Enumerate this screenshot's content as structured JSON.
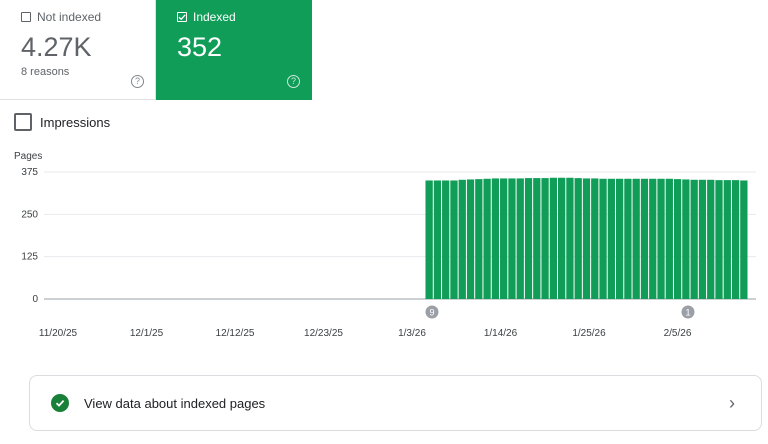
{
  "cards": {
    "not_indexed": {
      "label": "Not indexed",
      "value": "4.27K",
      "sub": "8 reasons",
      "checked": false
    },
    "indexed": {
      "label": "Indexed",
      "value": "352",
      "checked": true
    }
  },
  "impressions": {
    "label": "Impressions",
    "checked": false
  },
  "colors": {
    "indexed": "#0f9d58",
    "accent_check": "#188038"
  },
  "chart_data": {
    "type": "bar",
    "ylabel": "Pages",
    "ylim": [
      0,
      375
    ],
    "yticks": [
      0,
      125,
      250,
      375
    ],
    "xticks": [
      "11/20/25",
      "12/1/25",
      "12/12/25",
      "12/23/25",
      "1/3/26",
      "1/14/26",
      "1/25/26",
      "2/5/26"
    ],
    "annotations": [
      {
        "label": "9",
        "date": "1/3/26"
      },
      {
        "label": "1",
        "date": "2/3/26"
      }
    ],
    "series": [
      {
        "values": [
          0,
          0,
          0,
          0,
          0,
          0,
          0,
          0,
          0,
          0,
          0,
          0,
          0,
          0,
          0,
          0,
          0,
          0,
          0,
          0,
          0,
          0,
          0,
          0,
          0,
          0,
          0,
          0,
          0,
          0,
          0,
          0,
          0,
          0,
          0,
          0,
          0,
          0,
          0,
          0,
          0,
          0,
          0,
          0,
          0,
          0,
          350,
          350,
          350,
          350,
          352,
          353,
          354,
          355,
          356,
          356,
          356,
          356,
          357,
          357,
          357,
          358,
          358,
          358,
          357,
          356,
          356,
          355,
          355,
          355,
          355,
          355,
          355,
          355,
          355,
          355,
          354,
          353,
          352,
          352,
          352,
          351,
          351,
          351,
          350
        ]
      }
    ]
  },
  "link": {
    "label": "View data about indexed pages"
  }
}
